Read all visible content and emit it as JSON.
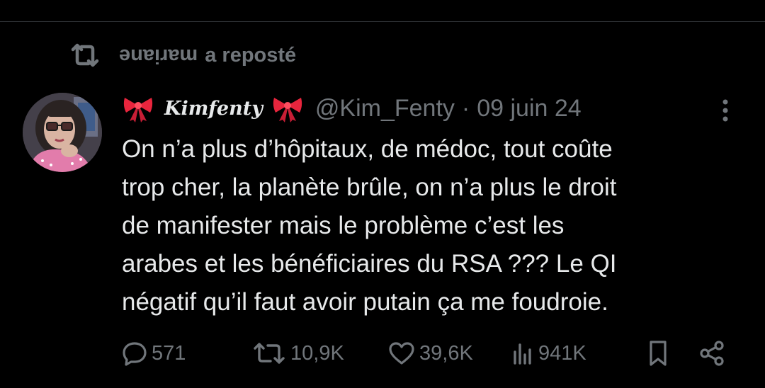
{
  "repost": {
    "user_flipped": "mariane",
    "label": "a reposté"
  },
  "tweet": {
    "display_name": "Kimfenty",
    "handle": "@Kim_Fenty",
    "separator": "·",
    "date": "09 juin 24",
    "text": "On n’a plus d’hôpitaux, de médoc, tout coûte\ntrop cher, la planète brûle, on n’a plus le droit\nde manifester mais le problème c’est les\narabes et les bénéficiaires du RSA ??? Le QI\nnégatif qu’il faut avoir putain ça me foudroie."
  },
  "actions": {
    "replies": "571",
    "reposts": "10,9K",
    "likes": "39,6K",
    "views": "941K"
  },
  "colors": {
    "background": "#000000",
    "text": "#e7e9ea",
    "secondary": "#71767b",
    "bow": "#e8253d"
  },
  "icons": [
    "repost-icon",
    "bow-icon",
    "more-icon",
    "reply-icon",
    "retweet-icon",
    "like-icon",
    "views-icon",
    "bookmark-icon",
    "share-icon"
  ]
}
